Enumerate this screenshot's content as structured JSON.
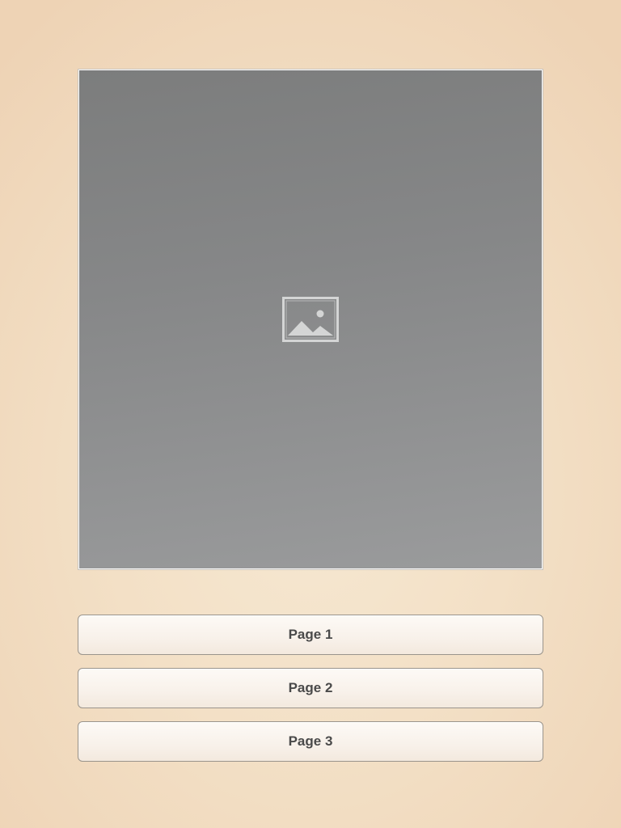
{
  "image_view": {
    "icon": "image-placeholder-icon"
  },
  "buttons": [
    {
      "label": "Page 1"
    },
    {
      "label": "Page 2"
    },
    {
      "label": "Page 3"
    }
  ],
  "colors": {
    "background": "#f3e0c6",
    "image_placeholder": "#888989",
    "button_text": "#4a4a4a",
    "button_border": "#9a948c"
  }
}
